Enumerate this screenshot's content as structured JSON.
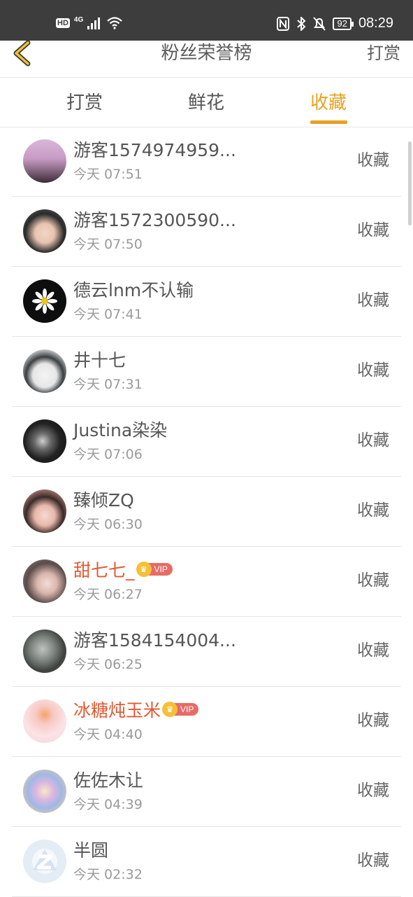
{
  "status_bar": {
    "hd": "HD",
    "network": "4G",
    "battery": "92",
    "time": "08:29"
  },
  "header": {
    "title": "粉丝荣誉榜",
    "right_link": "打赏"
  },
  "tabs": [
    {
      "label": "打赏",
      "active": false
    },
    {
      "label": "鲜花",
      "active": false
    },
    {
      "label": "收藏",
      "active": true
    }
  ],
  "colors": {
    "accent": "#e9a122",
    "vip_name": "#e05a33",
    "status_bar": "#3d3d3d"
  },
  "list": [
    {
      "name": "游客1574974959...",
      "time": "今天 07:51",
      "action": "收藏",
      "vip": false
    },
    {
      "name": "游客1572300590...",
      "time": "今天 07:50",
      "action": "收藏",
      "vip": false
    },
    {
      "name": "德云lnm不认输",
      "time": "今天 07:41",
      "action": "收藏",
      "vip": false
    },
    {
      "name": "井十七",
      "time": "今天 07:31",
      "action": "收藏",
      "vip": false
    },
    {
      "name": "Justina染染",
      "time": "今天 07:06",
      "action": "收藏",
      "vip": false
    },
    {
      "name": "臻倾ZQ",
      "time": "今天 06:30",
      "action": "收藏",
      "vip": false
    },
    {
      "name": "甜七七_",
      "time": "今天 06:27",
      "action": "收藏",
      "vip": true,
      "badge": "VIP"
    },
    {
      "name": "游客1584154004...",
      "time": "今天 06:25",
      "action": "收藏",
      "vip": false
    },
    {
      "name": "冰糖炖玉米",
      "time": "今天 04:40",
      "action": "收藏",
      "vip": true,
      "badge": "VIP"
    },
    {
      "name": "佐佐木让",
      "time": "今天 04:39",
      "action": "收藏",
      "vip": false
    },
    {
      "name": "半圆",
      "time": "今天 02:32",
      "action": "收藏",
      "vip": false
    }
  ]
}
